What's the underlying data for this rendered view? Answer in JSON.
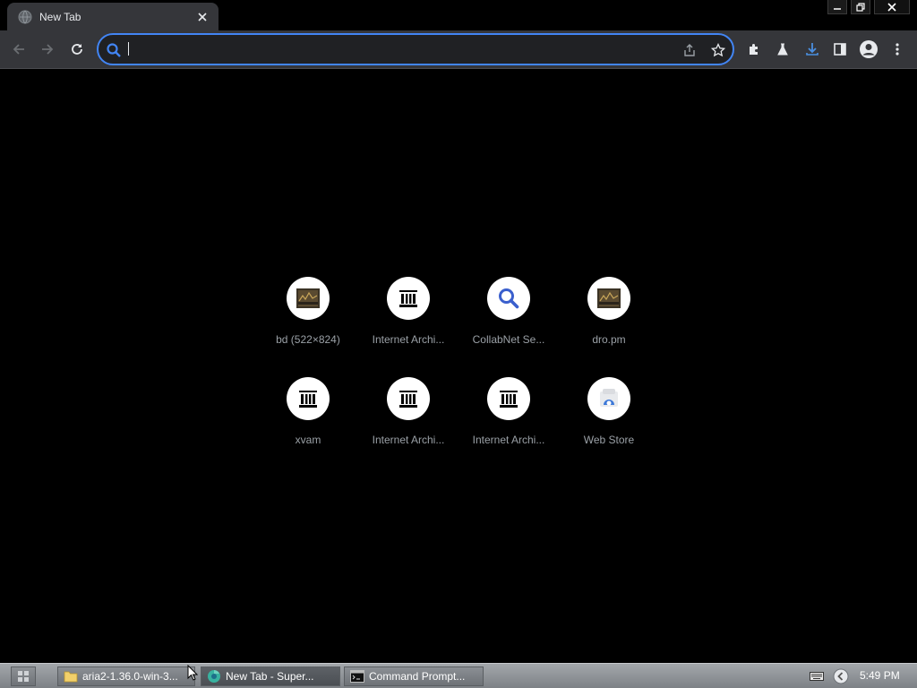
{
  "tab": {
    "title": "New Tab",
    "favicon": "globe-icon"
  },
  "window_controls": [
    "minimize-icon",
    "restore-icon",
    "close-icon"
  ],
  "toolbar": {
    "back": "back-arrow-icon",
    "forward": "forward-arrow-icon",
    "reload": "reload-icon",
    "omnibox": {
      "value": "",
      "placeholder": ""
    },
    "accent_color": "#4285f4",
    "right_icons": [
      "extensions-icon",
      "labs-icon",
      "download-icon",
      "side-panel-icon",
      "profile-icon",
      "menu-icon"
    ]
  },
  "shortcuts": [
    {
      "label": "bd (522×824)",
      "icon": "thumbnail-icon"
    },
    {
      "label": "Internet Archi...",
      "icon": "archive-icon"
    },
    {
      "label": "CollabNet Se...",
      "icon": "search-icon"
    },
    {
      "label": "dro.pm",
      "icon": "thumbnail-icon"
    },
    {
      "label": "xvam",
      "icon": "archive-icon"
    },
    {
      "label": "Internet Archi...",
      "icon": "archive-icon"
    },
    {
      "label": "Internet Archi...",
      "icon": "archive-icon"
    },
    {
      "label": "Web Store",
      "icon": "web-store-icon"
    }
  ],
  "taskbar": {
    "tasks": [
      {
        "label": "aria2-1.36.0-win-3...",
        "icon": "folder-icon"
      },
      {
        "label": "New Tab - Super...",
        "icon": "browser-icon"
      },
      {
        "label": "Command Prompt...",
        "icon": "terminal-icon"
      }
    ],
    "clock": "5:49 PM"
  }
}
